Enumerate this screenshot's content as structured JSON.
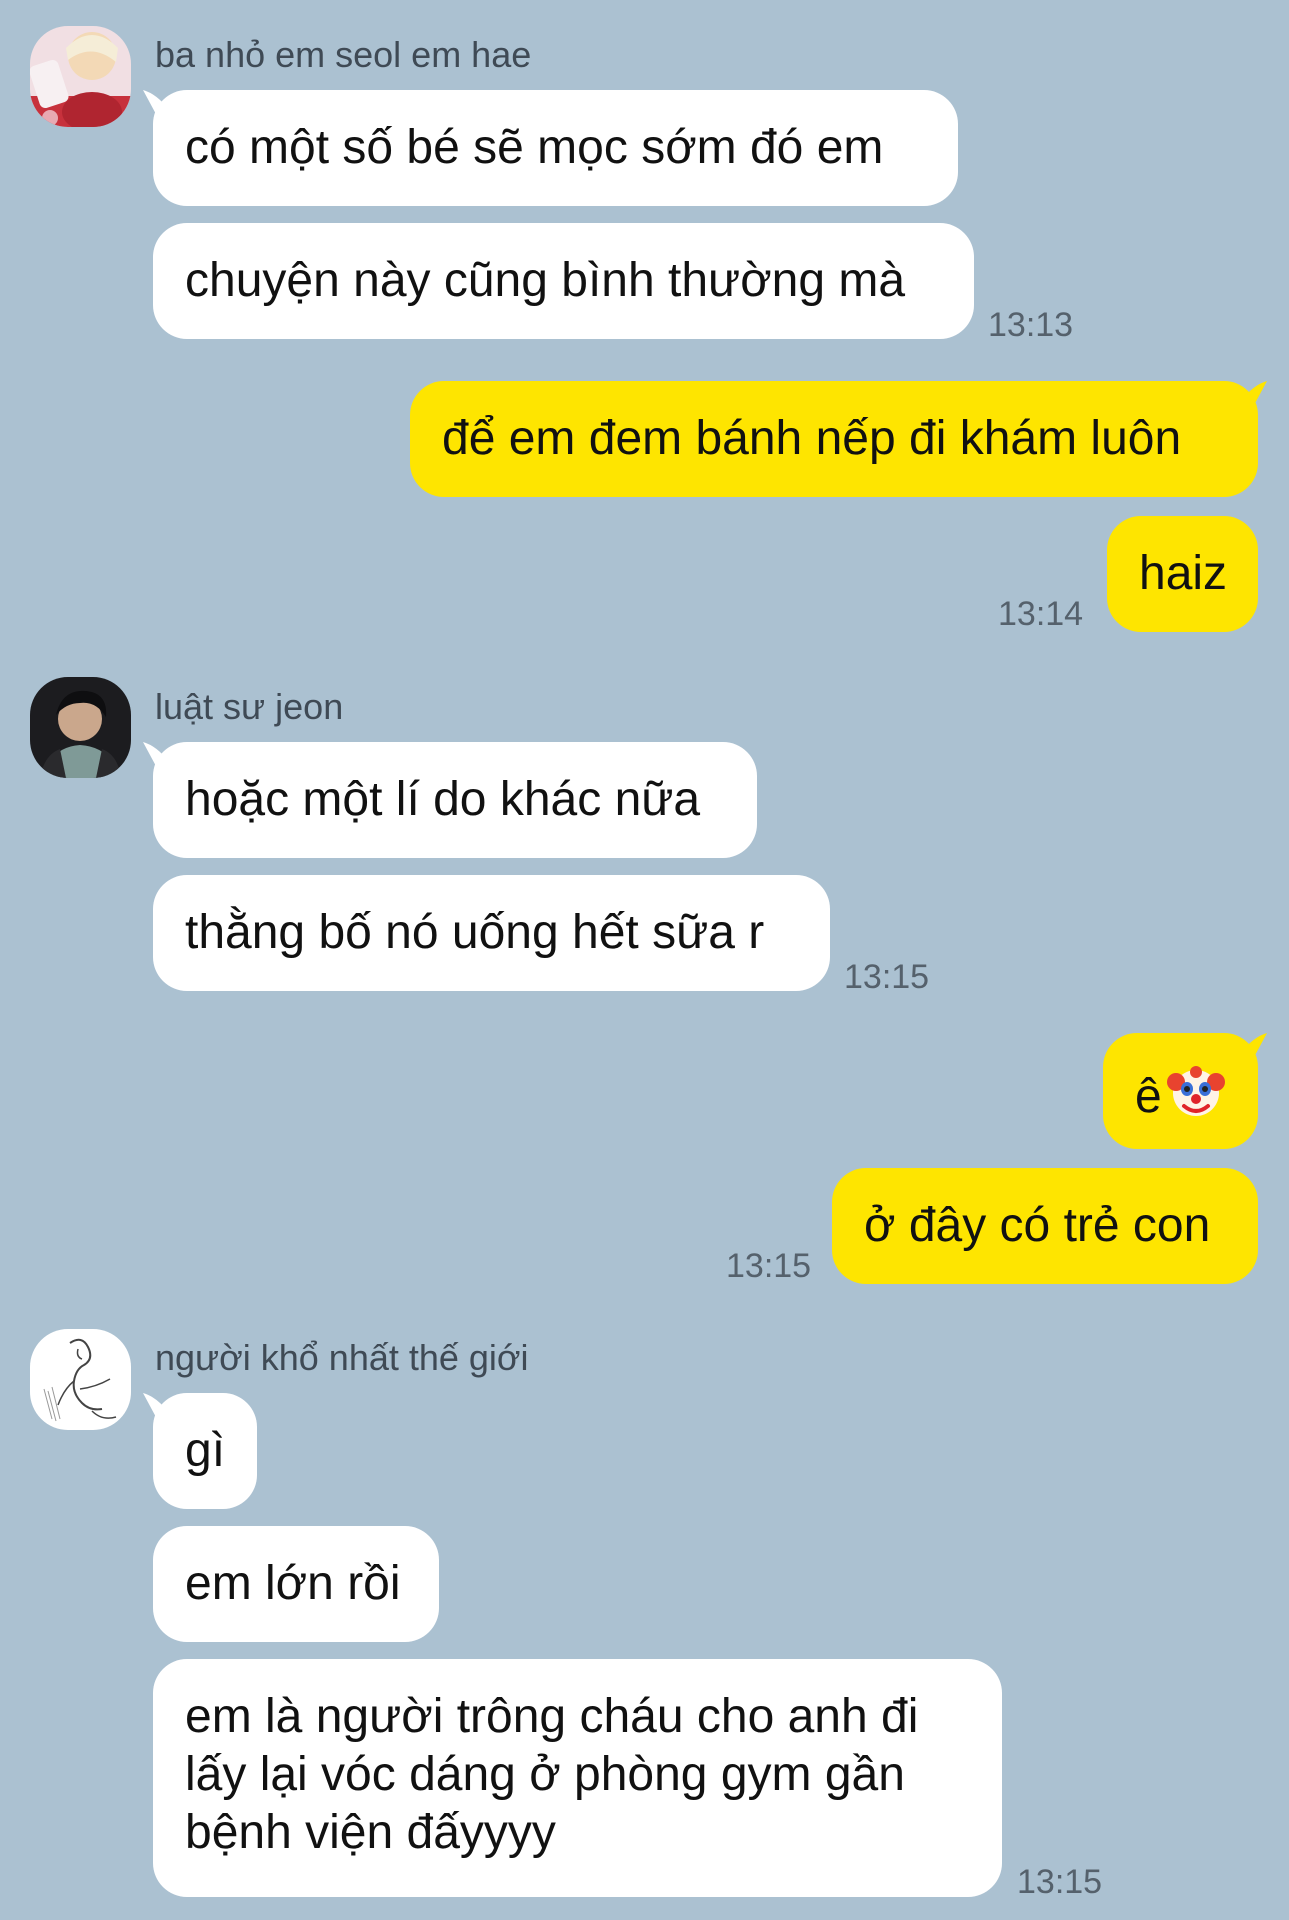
{
  "conversation": {
    "group1": {
      "sender": "ba nhỏ em seol em hae",
      "messages": [
        "có một số bé sẽ mọc sớm đó em",
        "chuyện này cũng bình thường mà"
      ],
      "time": "13:13"
    },
    "mine1": {
      "messages": [
        "để em đem bánh nếp đi khám luôn",
        "haiz"
      ],
      "time": "13:14"
    },
    "group2": {
      "sender": "luật sư jeon",
      "messages": [
        "hoặc một lí do khác nữa",
        "thằng bố nó uống hết sữa r"
      ],
      "time": "13:15"
    },
    "mine2": {
      "messages": [
        "ê",
        "ở đây có trẻ con"
      ],
      "emoji": "clown-face-icon",
      "time": "13:15"
    },
    "group3": {
      "sender": "người khổ nhất thế giới",
      "messages": [
        "gì",
        "em lớn rồi"
      ],
      "long_message_lines": [
        "em là người trông cháu cho anh đi",
        "lấy lại vóc dáng ở phòng gym gần",
        "bệnh viện đấyyyy"
      ],
      "time": "13:15"
    }
  },
  "colors": {
    "background": "#abc1d1",
    "incoming_bubble": "#ffffff",
    "outgoing_bubble": "#fee500",
    "timestamp": "#55616c"
  }
}
